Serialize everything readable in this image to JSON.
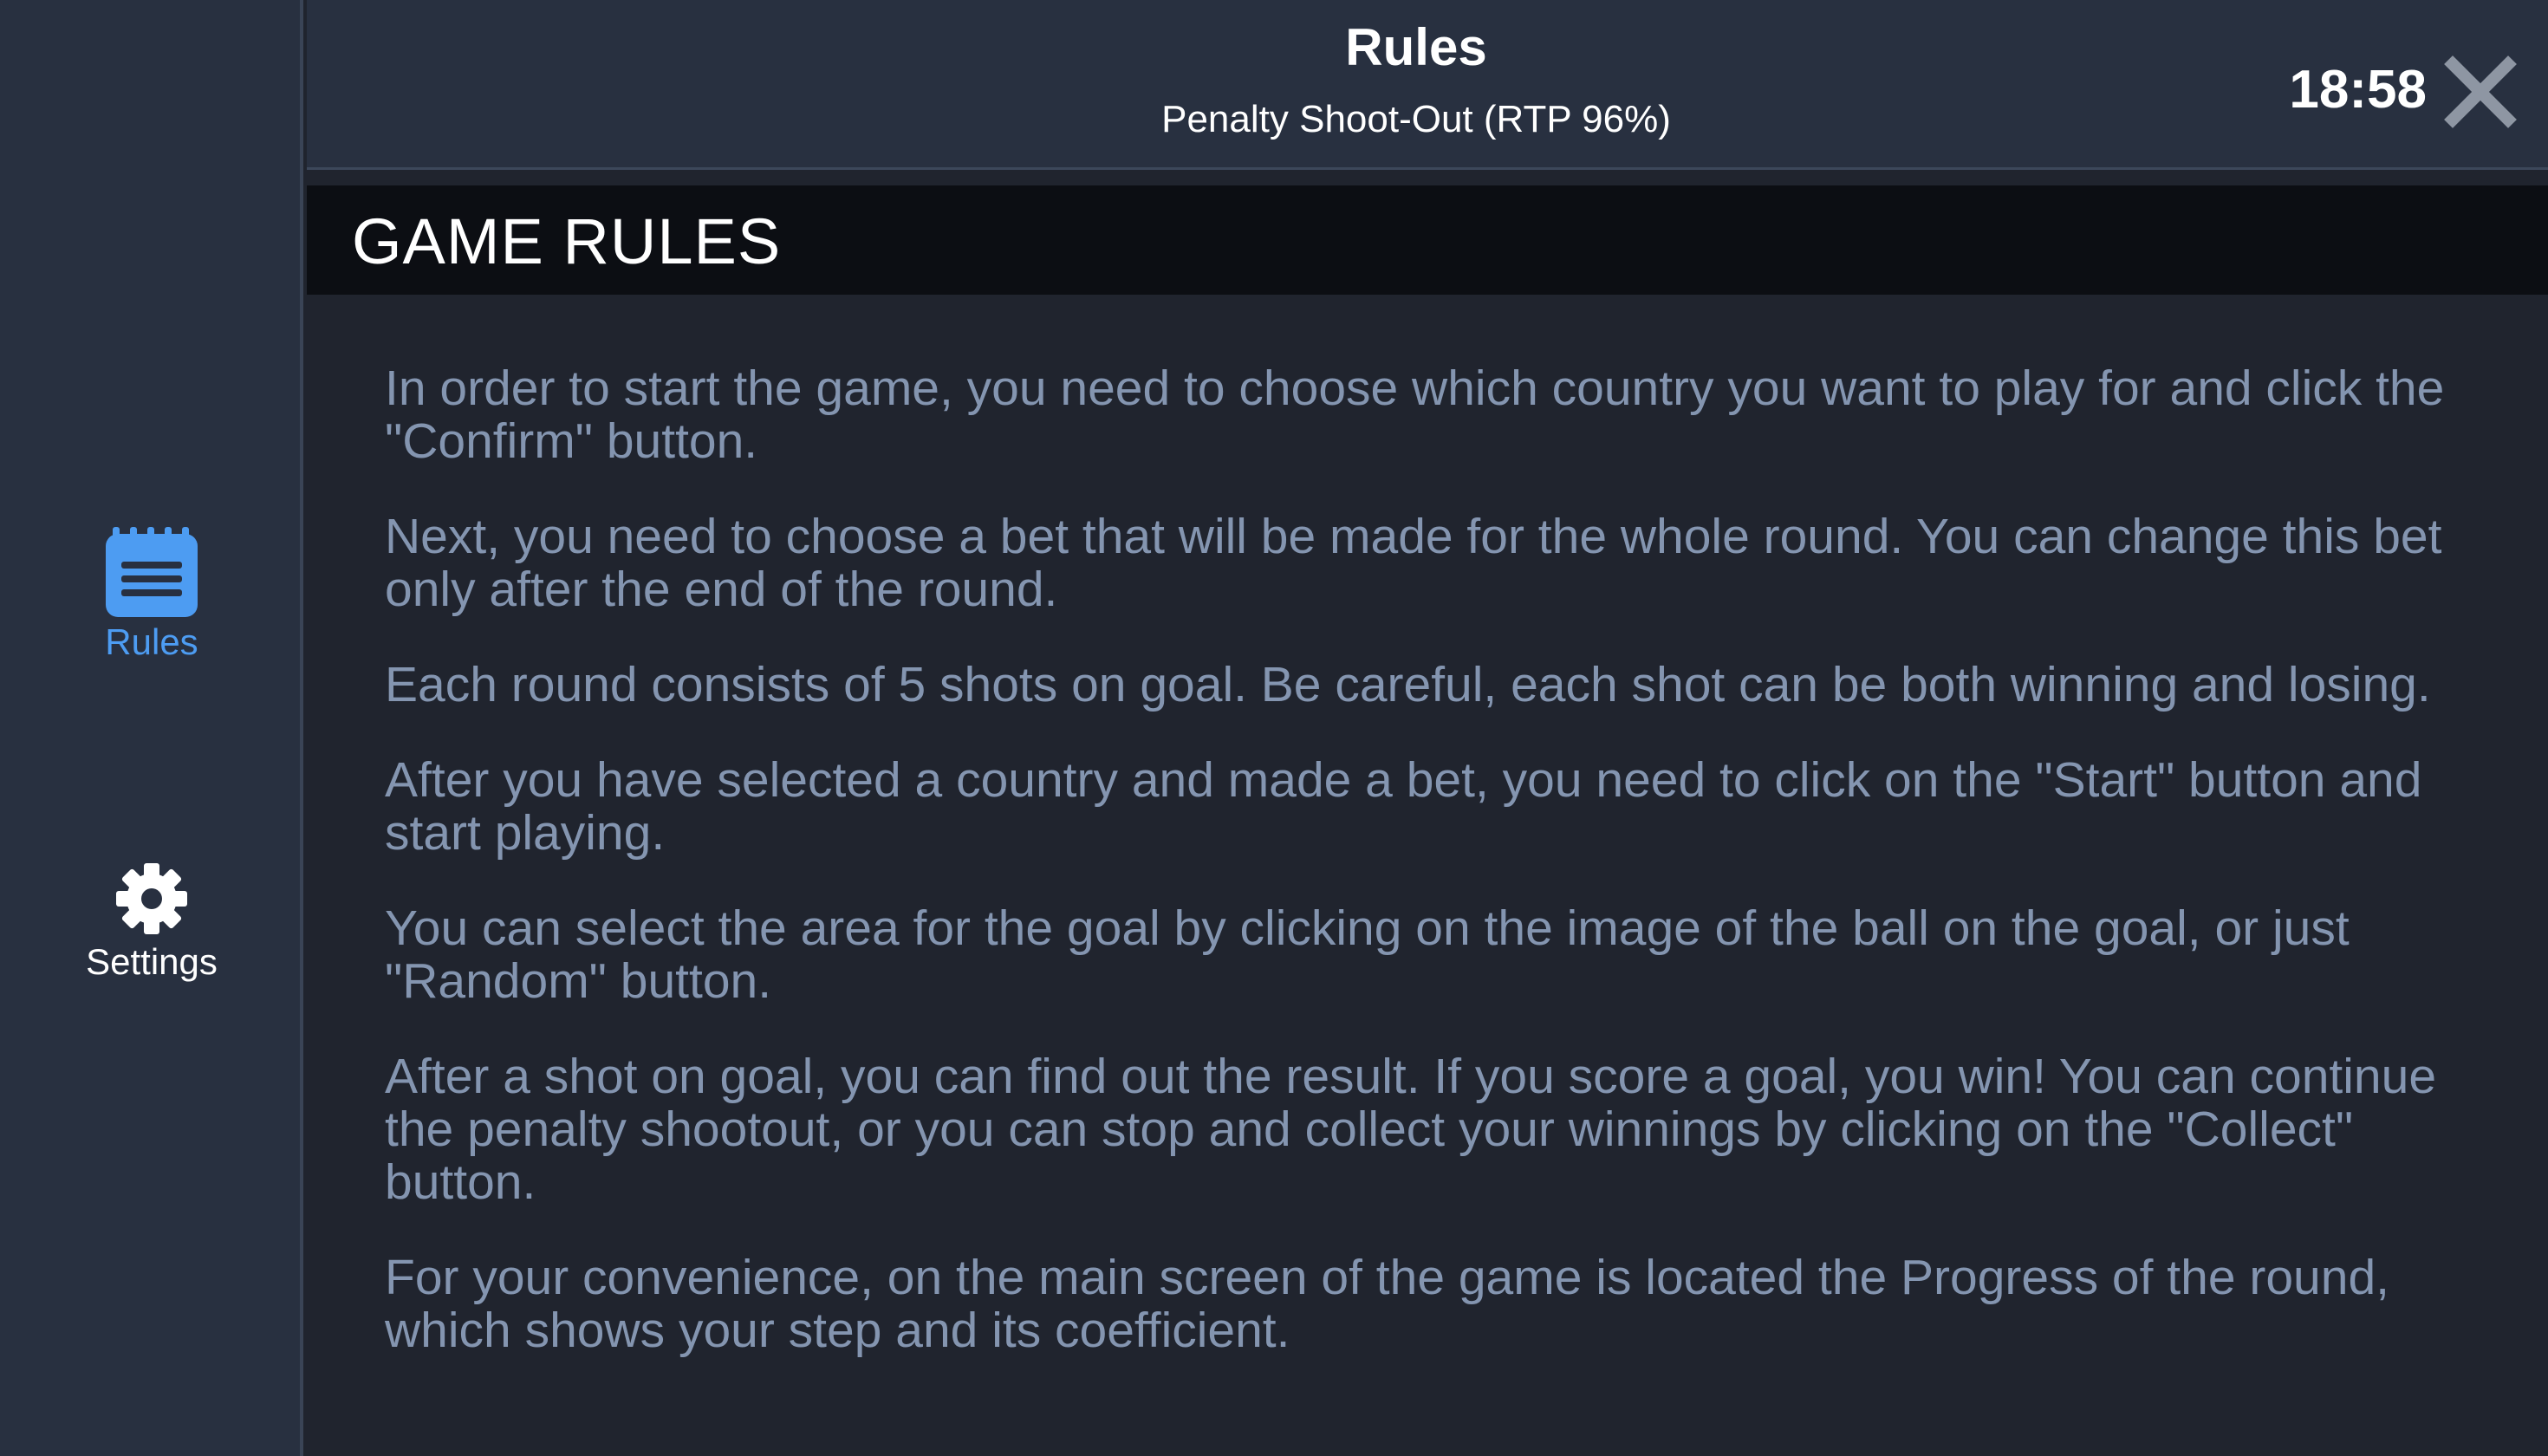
{
  "sidebar": {
    "items": [
      {
        "label": "Rules",
        "icon": "rules-icon",
        "active": true,
        "color": "#4d9cf2"
      },
      {
        "label": "Settings",
        "icon": "gear-icon",
        "active": false,
        "color": "#ffffff"
      }
    ]
  },
  "header": {
    "title": "Rules",
    "subtitle": "Penalty Shoot-Out (RTP 96%)",
    "time": "18:58",
    "close_icon": "close-icon"
  },
  "section": {
    "title": "GAME RULES"
  },
  "rules": {
    "paragraphs": [
      "In order to start the game, you need to choose which country you want to play for and click the \"Confirm\" button.",
      "Next, you need to choose a bet that will be made for the whole round. You can change this bet only after the end of the round.",
      "Each round consists of 5 shots on goal. Be careful, each shot can be both winning and losing.",
      "After you have selected a country and made a bet, you need to click on the \"Start\" button and start playing.",
      "You can select the area for the goal by clicking on the image of the ball on the goal, or just \"Random\" button.",
      "After a shot on goal, you can find out the result. If you score a goal, you win! You can continue the penalty shootout, or you can stop and collect your winnings by clicking on the \"Collect\" button.",
      "For your convenience, on the main screen of the game is located the Progress of the round, which shows your step and its coefficient."
    ]
  },
  "colors": {
    "background": "#20242e",
    "sidebar": "#283040",
    "section_bar": "#0c0e13",
    "text_muted": "#8495b0",
    "accent": "#4d9cf2"
  }
}
